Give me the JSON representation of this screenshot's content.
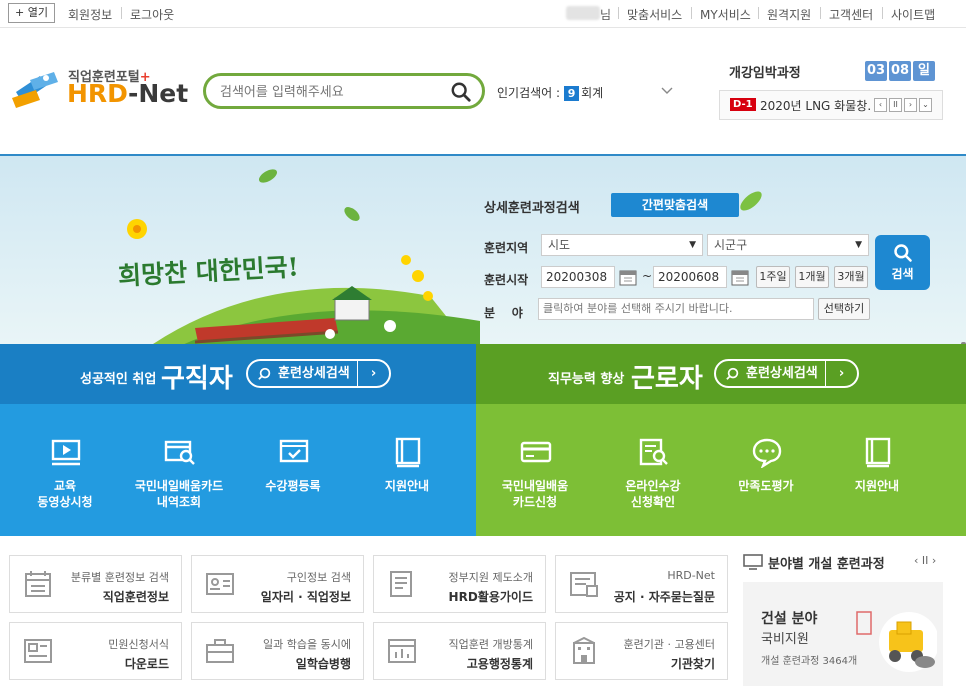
{
  "topbar": {
    "open_label": "+ 열기",
    "member_info": "회원정보",
    "logout": "로그아웃",
    "user_suffix": "님",
    "links": [
      "맞춤서비스",
      "MY서비스",
      "원격지원",
      "고객센터",
      "사이트맵"
    ]
  },
  "header": {
    "logo_sub": "직업훈련포털",
    "logo_plus": "+",
    "logo_main_a": "HRD",
    "logo_main_b": "-Net",
    "search_placeholder": "검색어를 입력해주세요",
    "popular_label": "인기검색어 :",
    "popular_rank": "9",
    "popular_term": "회계",
    "opening_title": "개강임박과정",
    "count_digits": [
      "03",
      "08"
    ],
    "count_unit": "일",
    "notice_badge": "D-1",
    "notice_text": "2020년 LNG 화물창…"
  },
  "hero": {
    "slogan": "희망찬 대한민국!",
    "detail_title": "상세훈련과정검색",
    "simple_search": "간편맞춤검색",
    "region_label": "훈련지역",
    "region_sido": "시도",
    "region_sigungu": "시군구",
    "start_label": "훈련시작",
    "date_from": "20200308",
    "tilde": "~",
    "date_to": "20200608",
    "periods": [
      "1주일",
      "1개월",
      "3개월"
    ],
    "field_label": "분    야",
    "field_placeholder": "클릭하여 분야를 선택해 주시기 바랍니다.",
    "select_btn": "선택하기",
    "search_btn": "검색"
  },
  "jobseeker": {
    "small": "성공적인 취업",
    "big": "구직자",
    "btn": "훈련상세검색",
    "chevron": "›",
    "color": "#1a7fc4",
    "tile_color": "#239be0",
    "tiles": [
      {
        "icon": "video-player-icon",
        "label1": "교육",
        "label2": "동영상시청"
      },
      {
        "icon": "card-search-icon",
        "label1": "국민내일배움카드",
        "label2": "내역조회"
      },
      {
        "icon": "monitor-check-icon",
        "label1": "수강평등록",
        "label2": ""
      },
      {
        "icon": "guide-book-icon",
        "label1": "지원안내",
        "label2": ""
      }
    ]
  },
  "worker": {
    "small": "직무능력 향상",
    "big": "근로자",
    "btn": "훈련상세검색",
    "chevron": "›",
    "color": "#5a9f23",
    "tile_color": "#7dbf36",
    "tiles": [
      {
        "icon": "credit-card-icon",
        "label1": "국민내일배움",
        "label2": "카드신청"
      },
      {
        "icon": "document-search-icon",
        "label1": "온라인수강",
        "label2": "신청확인"
      },
      {
        "icon": "chat-bubble-icon",
        "label1": "만족도평가",
        "label2": ""
      },
      {
        "icon": "guide-book-icon",
        "label1": "지원안내",
        "label2": ""
      }
    ]
  },
  "links": [
    {
      "icon": "calendar-list-icon",
      "t1": "분류별 훈련정보 검색",
      "t2": "직업훈련정보"
    },
    {
      "icon": "id-card-icon",
      "t1": "구인정보 검색",
      "t2": "일자리 · 직업정보"
    },
    {
      "icon": "document-icon",
      "t1": "정부지원 제도소개",
      "t2": "HRD활용가이드"
    },
    {
      "icon": "notice-board-icon",
      "t1": "HRD-Net",
      "t2": "공지 · 자주묻는질문"
    },
    {
      "icon": "form-download-icon",
      "t1": "민원신청서식",
      "t2": "다운로드"
    },
    {
      "icon": "briefcase-icon",
      "t1": "일과 학습을 동시에",
      "t2": "일학습병행"
    },
    {
      "icon": "bar-stats-icon",
      "t1": "직업훈련 개방통계",
      "t2": "고용행정통계"
    },
    {
      "icon": "building-icon",
      "t1": "훈련기관 · 고용센터",
      "t2": "기관찾기"
    }
  ],
  "side": {
    "title": "분야별 개설 훈련과정",
    "controls": "‹ II ›",
    "field": "건설 분야",
    "support": "국비지원",
    "count_text": "개설 훈련과정 3464개"
  }
}
